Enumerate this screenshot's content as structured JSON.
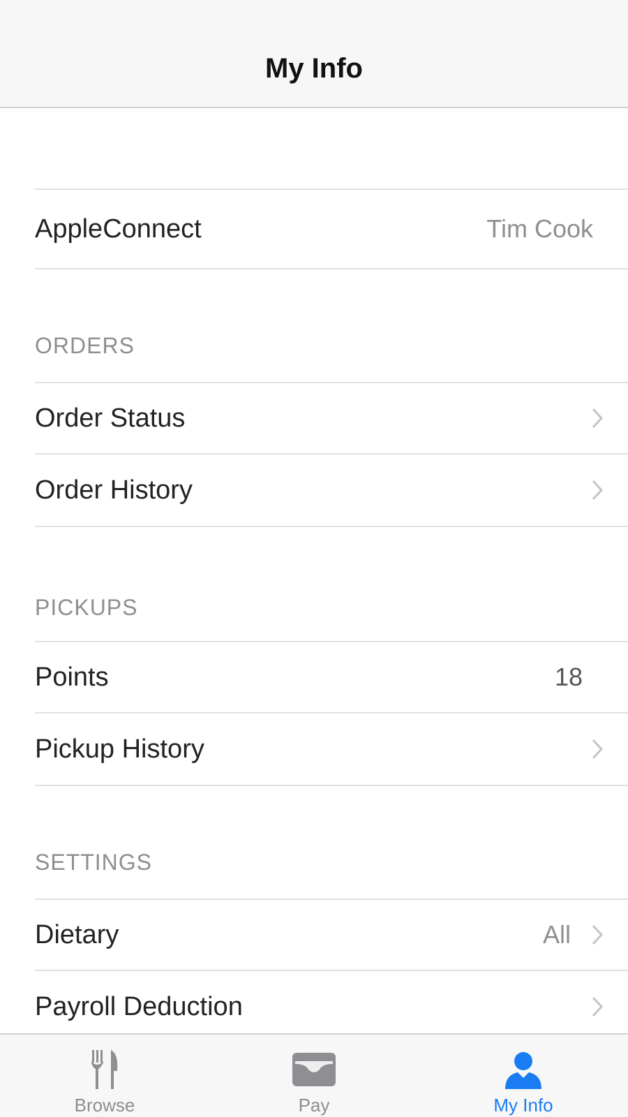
{
  "navbar": {
    "title": "My Info"
  },
  "account": {
    "label": "AppleConnect",
    "value": "Tim Cook"
  },
  "orders": {
    "header": "ORDERS",
    "items": [
      {
        "label": "Order Status"
      },
      {
        "label": "Order History"
      }
    ]
  },
  "pickups": {
    "header": "PICKUPS",
    "points": {
      "label": "Points",
      "value": "18"
    },
    "history": {
      "label": "Pickup History"
    }
  },
  "settings": {
    "header": "SETTINGS",
    "dietary": {
      "label": "Dietary",
      "value": "All"
    },
    "payroll": {
      "label": "Payroll Deduction"
    }
  },
  "tabbar": {
    "tabs": [
      {
        "label": "Browse",
        "icon": "fork-knife-icon",
        "active": false
      },
      {
        "label": "Pay",
        "icon": "wallet-icon",
        "active": false
      },
      {
        "label": "My Info",
        "icon": "person-icon",
        "active": true
      }
    ]
  },
  "colors": {
    "accent": "#1a7cf2",
    "inactive": "#8e8e93",
    "separator": "#e0e0e0",
    "bar_background": "#f7f7f7"
  }
}
